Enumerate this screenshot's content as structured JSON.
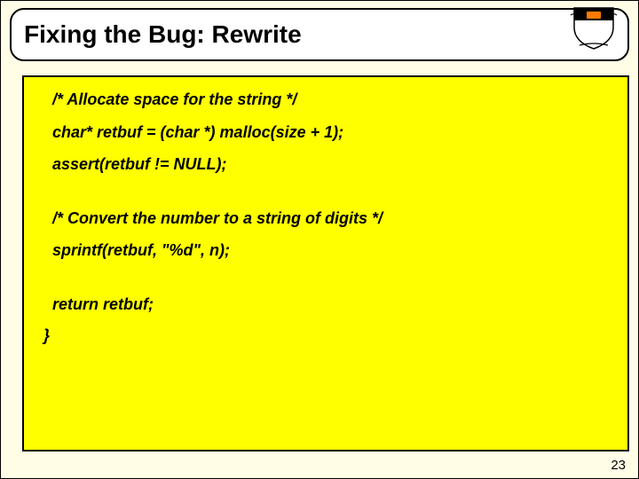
{
  "slide": {
    "title": "Fixing the Bug: Rewrite",
    "page_number": "23"
  },
  "code": {
    "l1": "  /* Allocate space for the string */",
    "l2": "  char* retbuf = (char *) malloc(size + 1);",
    "l3": "  assert(retbuf != NULL);",
    "l4": "  /* Convert the number to a string of digits */",
    "l5": "  sprintf(retbuf, \"%d\", n);",
    "l6": "  return retbuf;",
    "l7": "}"
  }
}
